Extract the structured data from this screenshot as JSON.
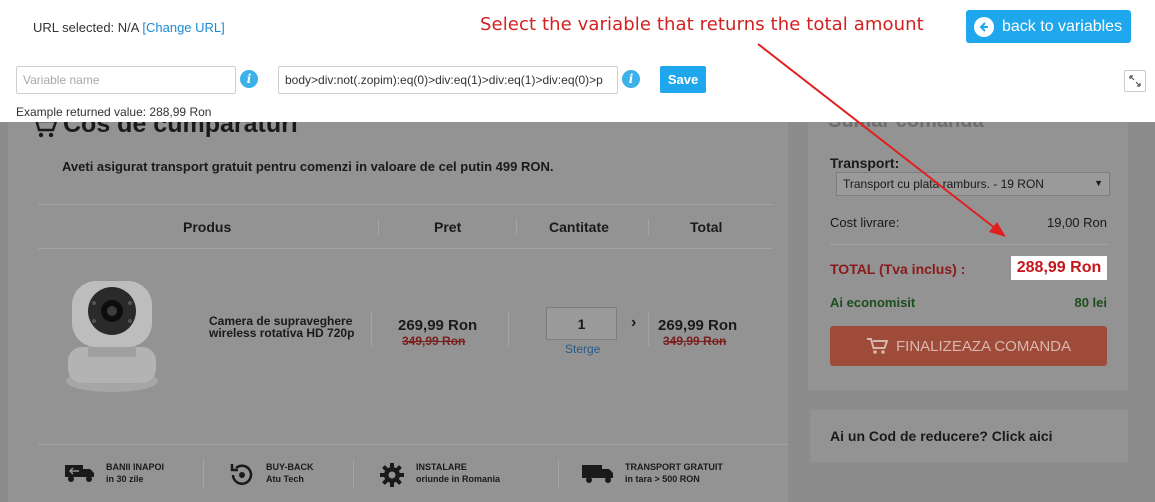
{
  "toolbar": {
    "url_selected_label": "URL selected:",
    "url_selected_value": "N/A",
    "change_url_link": "[Change URL]",
    "instruction": "Select the variable that returns the total amount",
    "back_button_label": "back to variables",
    "variable_name_placeholder": "Variable name",
    "selector_value": "body>div:not(.zopim):eq(0)>div:eq(1)>div:eq(1)>div:eq(0)>p",
    "save_label": "Save",
    "example_label": "Example returned value: 288,99 Ron"
  },
  "cart": {
    "title": "Cos de cumparaturi",
    "free_shipping_notice": "Aveti asigurat transport gratuit pentru comenzi in valoare de cel putin 499 RON.",
    "columns": [
      "Produs",
      "Pret",
      "Cantitate",
      "Total"
    ],
    "item": {
      "name_line1": "Camera de supraveghere",
      "name_line2": "wireless rotativa HD 720p",
      "price": "269,99 Ron",
      "old_price": "349,99 Ron",
      "quantity": "1",
      "remove_link": "Sterge",
      "total": "269,99 Ron",
      "old_total": "349,99 Ron"
    },
    "perks": [
      {
        "title": "BANII INAPOI",
        "sub": "in 30 zile"
      },
      {
        "title": "BUY-BACK",
        "sub": "Atu Tech"
      },
      {
        "title": "INSTALARE",
        "sub": "oriunde in Romania"
      },
      {
        "title": "TRANSPORT GRATUIT",
        "sub": "in tara > 500 RON"
      }
    ]
  },
  "summary": {
    "title": "Sumar comanda",
    "transport_label": "Transport:",
    "transport_option": "Transport cu plata ramburs. - 19 RON",
    "cost_label": "Cost livrare:",
    "cost_value": "19,00 Ron",
    "total_label": "TOTAL (Tva inclus) :",
    "total_value": "288,99 Ron",
    "savings_label": "Ai economisit",
    "savings_value": "80 lei",
    "checkout_label": "FINALIZEAZA COMANDA",
    "coupon_prompt": "Ai un Cod de reducere? Click aici"
  },
  "colors": {
    "accent": "#1ea7ec",
    "instruction": "#d32020",
    "overlay": "#8c8c8c",
    "highlight_total": "#c4161c"
  }
}
